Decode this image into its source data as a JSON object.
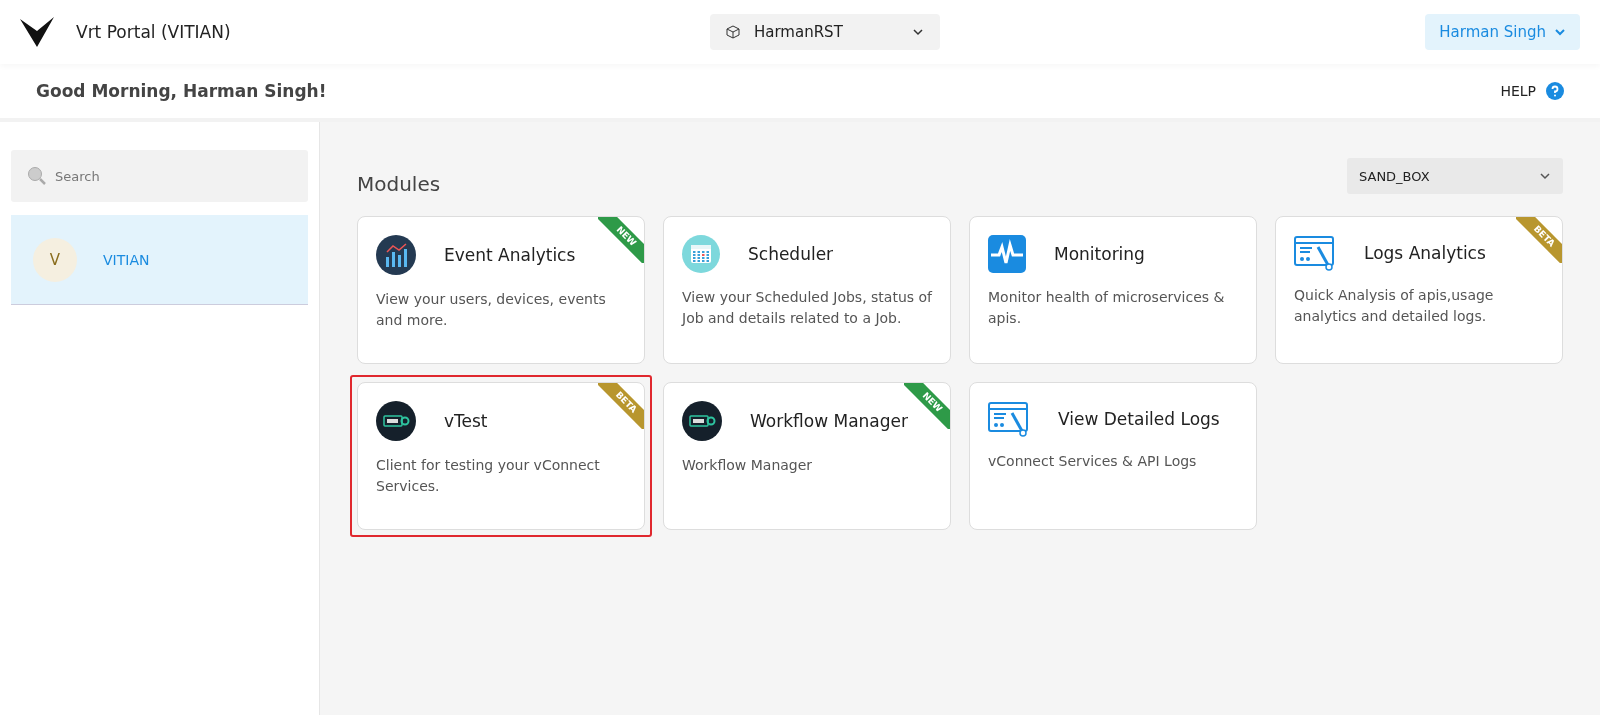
{
  "header": {
    "title": "Vrt Portal (VITIAN)",
    "project_select": "HarmanRST",
    "user_menu": "Harman Singh"
  },
  "greeting": "Good Morning, Harman Singh!",
  "help": "HELP",
  "sidebar": {
    "search": {
      "placeholder": "Search"
    },
    "items": [
      {
        "avatar": "V",
        "label": "VITIAN",
        "selected": true
      }
    ]
  },
  "modules": {
    "title": "Modules",
    "environment": "SAND_BOX",
    "cards": [
      {
        "kind": "analytics",
        "title": "Event Analytics",
        "description": "View your users, devices, events and more.",
        "ribbon": {
          "label": "NEW",
          "color": "#2e9a48"
        },
        "highlighted": false
      },
      {
        "kind": "calendar",
        "title": "Scheduler",
        "description": "View your Scheduled Jobs, status of Job and details related to a Job.",
        "highlighted": false
      },
      {
        "kind": "pulse",
        "title": "Monitoring",
        "description": "Monitor health of microservices & apis.",
        "highlighted": false
      },
      {
        "kind": "logs",
        "title": "Logs Analytics",
        "description": "Quick Analysis of apis,usage analytics and detailed logs.",
        "ribbon": {
          "label": "BETA",
          "color": "#b8962e"
        },
        "highlighted": false
      },
      {
        "kind": "api",
        "title": "vTest",
        "description": "Client for testing your vConnect Services.",
        "ribbon": {
          "label": "BETA",
          "color": "#b8962e"
        },
        "highlighted": true
      },
      {
        "kind": "api",
        "title": "Workflow Manager",
        "description": "Workflow Manager",
        "ribbon": {
          "label": "NEW",
          "color": "#2e9a48"
        },
        "highlighted": false
      },
      {
        "kind": "logs",
        "title": "View Detailed Logs",
        "description": "vConnect Services & API Logs",
        "highlighted": false
      }
    ]
  }
}
